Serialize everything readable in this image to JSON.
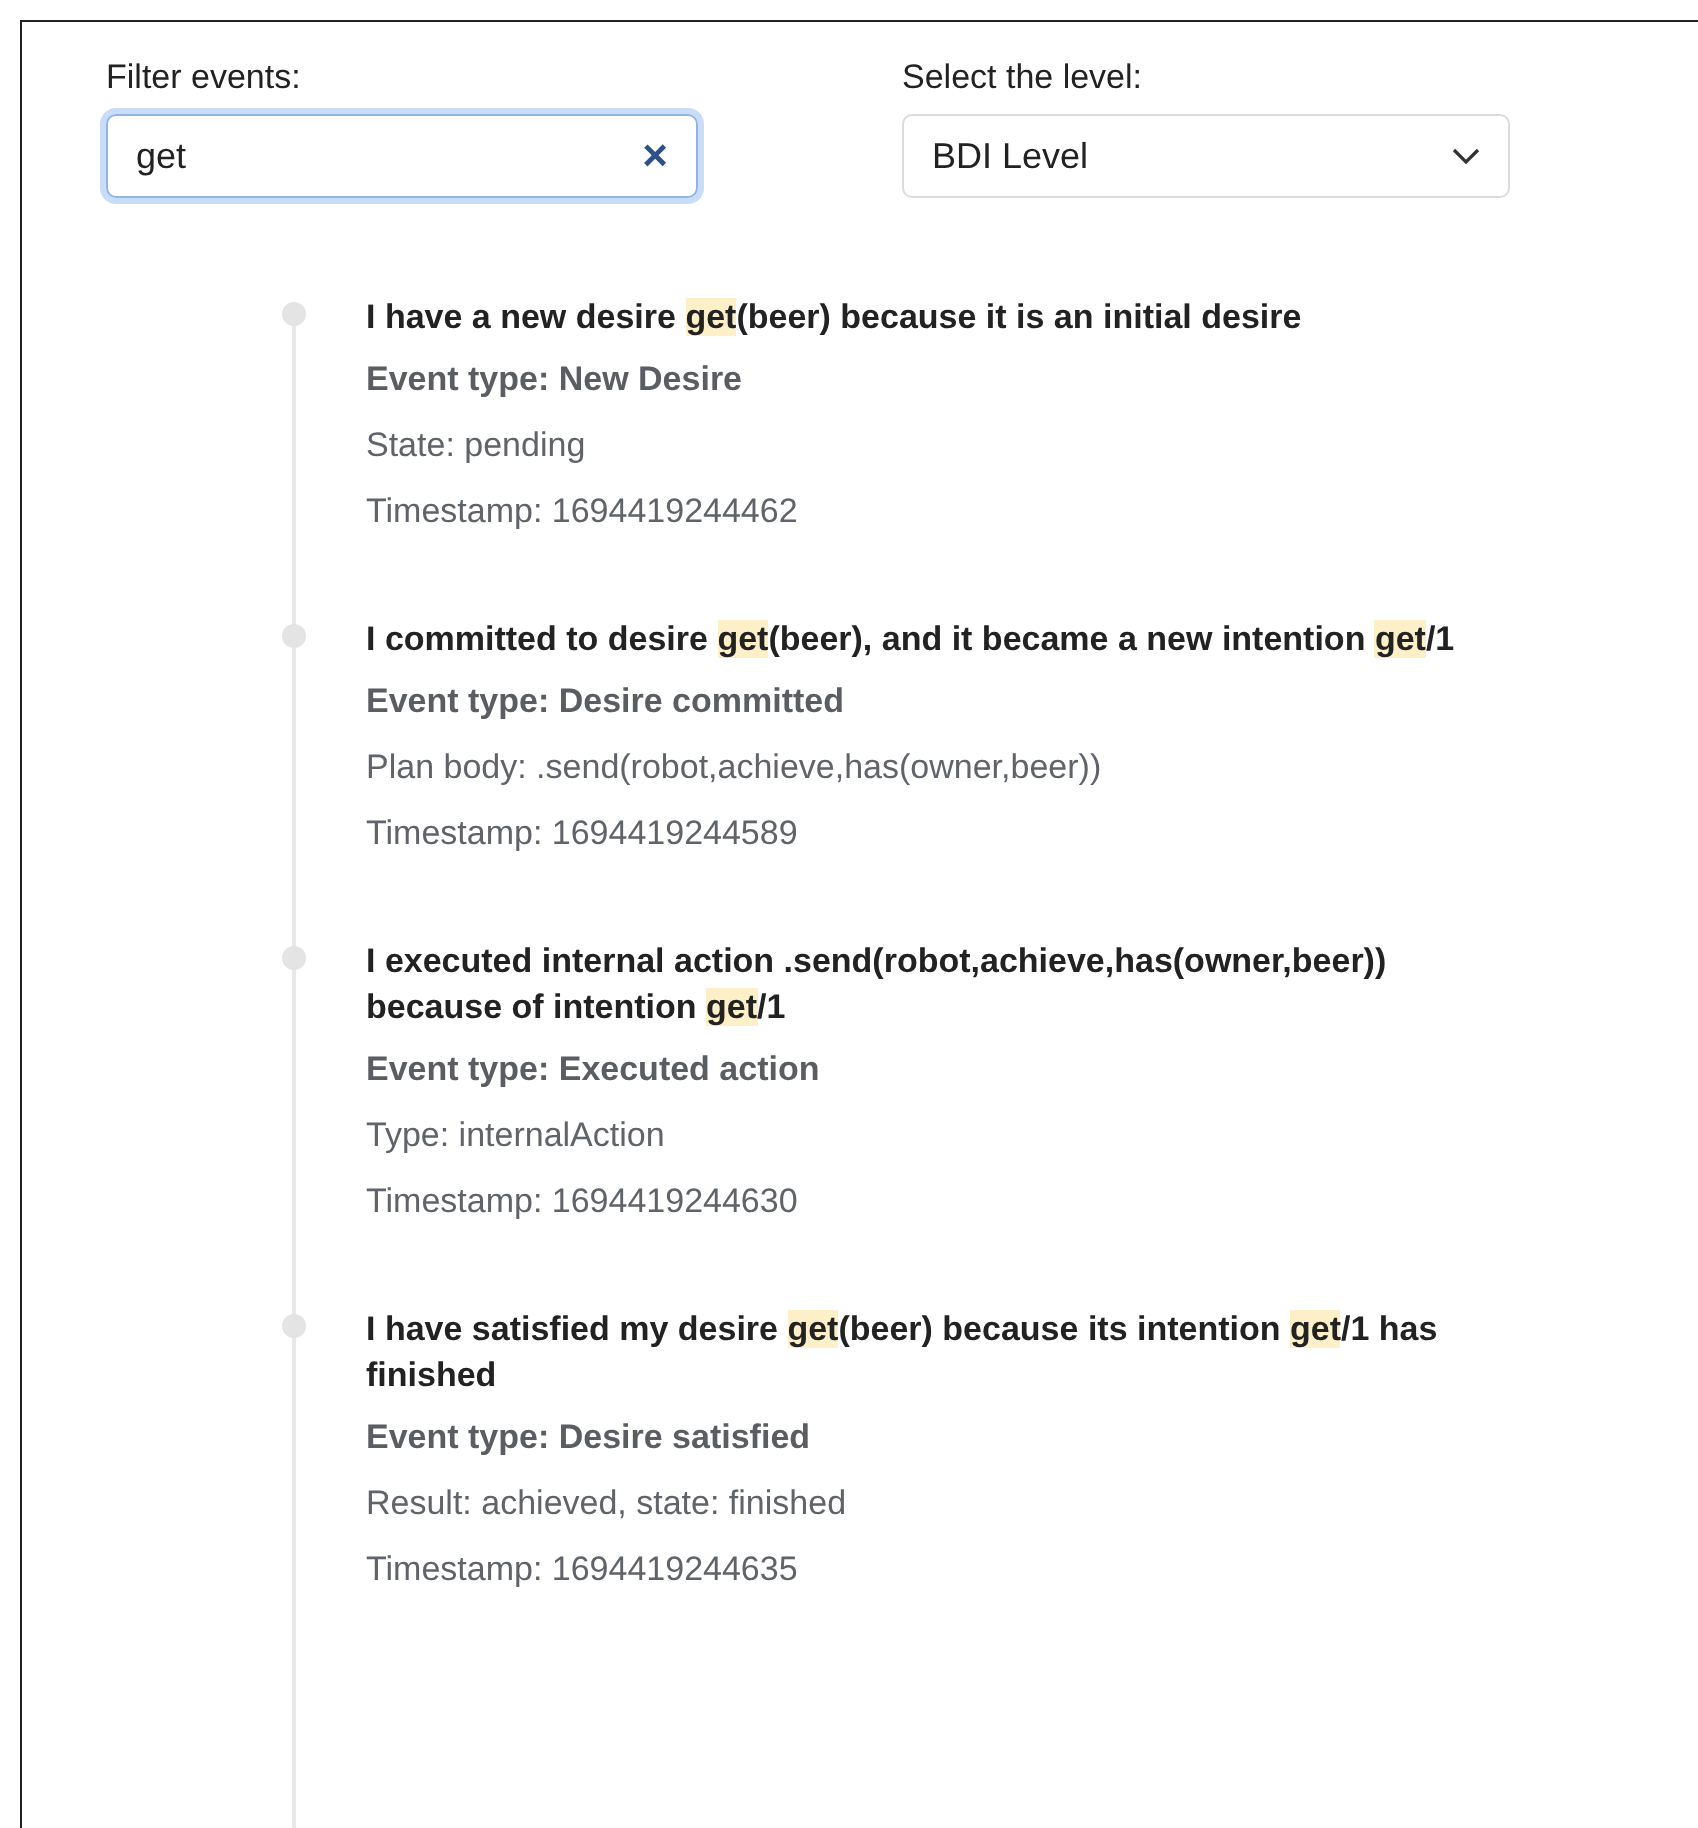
{
  "filter": {
    "label": "Filter events:",
    "value": "get",
    "clear_icon": "×",
    "focused": true
  },
  "level_select": {
    "label": "Select the level:",
    "value": "BDI Level"
  },
  "events": [
    {
      "title_parts": [
        {
          "text": "I have a new desire ",
          "highlight": false
        },
        {
          "text": "get",
          "highlight": true
        },
        {
          "text": "(beer) because it is an initial desire",
          "highlight": false
        }
      ],
      "event_type": "Event type: New Desire",
      "detail": "State: pending",
      "timestamp": "Timestamp: 1694419244462"
    },
    {
      "title_parts": [
        {
          "text": "I committed to desire ",
          "highlight": false
        },
        {
          "text": "get",
          "highlight": true
        },
        {
          "text": "(beer), and it became a new intention ",
          "highlight": false
        },
        {
          "text": "get",
          "highlight": true
        },
        {
          "text": "/1",
          "highlight": false
        }
      ],
      "event_type": "Event type: Desire committed",
      "detail": "Plan body: .send(robot,achieve,has(owner,beer))",
      "timestamp": "Timestamp: 1694419244589"
    },
    {
      "title_parts": [
        {
          "text": "I executed internal action .send(robot,achieve,has(owner,beer)) because of intention ",
          "highlight": false
        },
        {
          "text": "get",
          "highlight": true
        },
        {
          "text": "/1",
          "highlight": false
        }
      ],
      "event_type": "Event type: Executed action",
      "detail": "Type: internalAction",
      "timestamp": "Timestamp: 1694419244630"
    },
    {
      "title_parts": [
        {
          "text": "I have satisfied my desire ",
          "highlight": false
        },
        {
          "text": "get",
          "highlight": true
        },
        {
          "text": "(beer) because its intention ",
          "highlight": false
        },
        {
          "text": "get",
          "highlight": true
        },
        {
          "text": "/1 has finished",
          "highlight": false
        }
      ],
      "event_type": "Event type: Desire satisfied",
      "detail": "Result: achieved, state: finished",
      "timestamp": "Timestamp: 1694419244635"
    }
  ]
}
